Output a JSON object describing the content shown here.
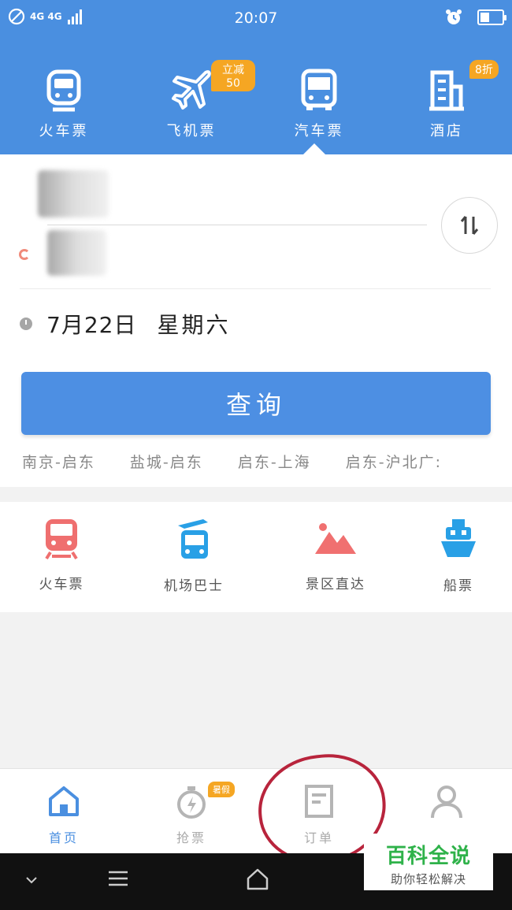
{
  "status_bar": {
    "network": "4G 4G",
    "time": "20:07",
    "icons": [
      "no-disturb-icon",
      "signal-icon",
      "alarm-icon",
      "battery-icon"
    ]
  },
  "top_tabs": [
    {
      "label": "火车票",
      "icon": "train-icon",
      "badge": ""
    },
    {
      "label": "飞机票",
      "icon": "plane-icon",
      "badge": "立减50"
    },
    {
      "label": "汽车票",
      "icon": "bus-icon",
      "badge": ""
    },
    {
      "label": "酒店",
      "icon": "hotel-icon",
      "badge": "8折"
    }
  ],
  "active_tab": "汽车票",
  "search": {
    "date": "7月22日",
    "weekday": "星期六",
    "query_button": "查询",
    "history": [
      "南京-启东",
      "盐城-启东",
      "启东-上海",
      "启东-沪北广:"
    ]
  },
  "services": [
    {
      "label": "火车票",
      "icon": "train-icon"
    },
    {
      "label": "机场巴士",
      "icon": "airport-bus-icon"
    },
    {
      "label": "景区直达",
      "icon": "mountain-icon"
    },
    {
      "label": "船票",
      "icon": "ship-icon"
    }
  ],
  "bottom_nav": [
    {
      "label": "首页",
      "icon": "home-icon",
      "active": true,
      "badge": ""
    },
    {
      "label": "抢票",
      "icon": "stopwatch-icon",
      "active": false,
      "badge": "暑假"
    },
    {
      "label": "订单",
      "icon": "order-icon",
      "active": false,
      "badge": ""
    },
    {
      "label": "",
      "icon": "user-icon",
      "active": false,
      "badge": ""
    }
  ],
  "watermark": {
    "main": "百科全说",
    "sub": "助你轻松解决"
  },
  "colors": {
    "primary": "#4a8fe0",
    "badge": "#f5a623",
    "annotation": "#b8243c",
    "watermark_green": "#2fb24a"
  }
}
